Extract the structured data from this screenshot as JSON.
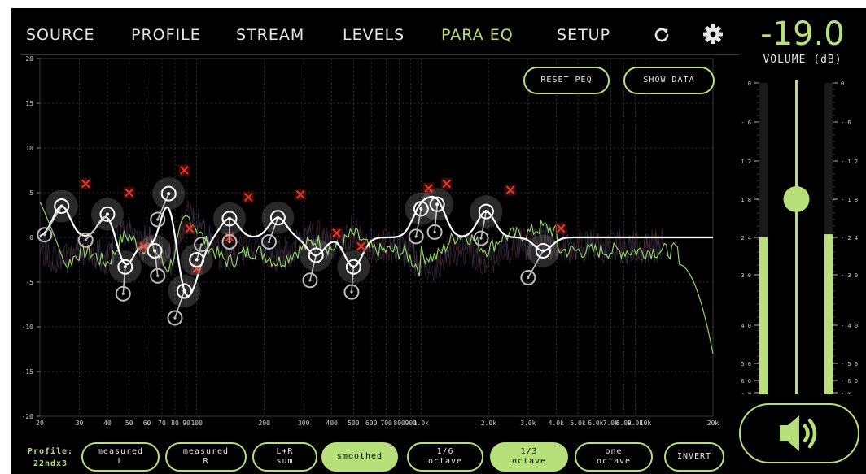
{
  "nav": {
    "tabs": [
      {
        "label": "SOURCE",
        "active": false
      },
      {
        "label": "PROFILE",
        "active": false
      },
      {
        "label": "STREAM",
        "active": false
      },
      {
        "label": "LEVELS",
        "active": false
      },
      {
        "label": "PARA EQ",
        "active": true
      },
      {
        "label": "SETUP",
        "active": false
      }
    ],
    "refresh_icon": "refresh-icon",
    "settings_icon": "gear-icon"
  },
  "volume": {
    "value": "-19.0",
    "label": "VOLUME (dB)",
    "slider_db": -18,
    "meter_left_db": -24,
    "meter_right_db": -23.5,
    "scale_left": [
      "0",
      "- 6",
      "- 1 2",
      "- 1 8",
      "- 2 4",
      "- 3 0",
      "- 4 0",
      "- 5 0",
      "- 6 0",
      "- ∞"
    ],
    "scale_right": [
      "0",
      "- 6",
      "- 1 2",
      "- 1 8",
      "- 2 4",
      "- 3 0",
      "- 4 0",
      "- 5 0",
      "- 6 0",
      "- ∞"
    ],
    "mute_icon": "speaker-icon"
  },
  "eq": {
    "reset_label": "RESET PEQ",
    "show_data_label": "SHOW DATA",
    "y_ticks": [
      "20",
      "15",
      "10",
      "5",
      "0",
      "-5",
      "-10",
      "-15",
      "-20"
    ],
    "x_ticks": [
      {
        "f": 20,
        "label": "20"
      },
      {
        "f": 30,
        "label": "30"
      },
      {
        "f": 40,
        "label": "40"
      },
      {
        "f": 50,
        "label": "50"
      },
      {
        "f": 60,
        "label": "60"
      },
      {
        "f": 70,
        "label": "70"
      },
      {
        "f": 80,
        "label": "80"
      },
      {
        "f": 90,
        "label": "90"
      },
      {
        "f": 100,
        "label": "100"
      },
      {
        "f": 200,
        "label": "200"
      },
      {
        "f": 300,
        "label": "300"
      },
      {
        "f": 400,
        "label": "400"
      },
      {
        "f": 500,
        "label": "500"
      },
      {
        "f": 600,
        "label": "600"
      },
      {
        "f": 700,
        "label": "700"
      },
      {
        "f": 800,
        "label": "800"
      },
      {
        "f": 900,
        "label": "900"
      },
      {
        "f": 1000,
        "label": "1.0k"
      },
      {
        "f": 2000,
        "label": "2.0k"
      },
      {
        "f": 3000,
        "label": "3.0k"
      },
      {
        "f": 4000,
        "label": "4.0k"
      },
      {
        "f": 5000,
        "label": "5.0k"
      },
      {
        "f": 6000,
        "label": "6.0k"
      },
      {
        "f": 7000,
        "label": "7.0k"
      },
      {
        "f": 8000,
        "label": "8.0k"
      },
      {
        "f": 9000,
        "label": "9.0k"
      },
      {
        "f": 10000,
        "label": "10k"
      },
      {
        "f": 20000,
        "label": "20k"
      }
    ],
    "colors": {
      "accent": "#b7e07a",
      "curve": "#ffffff",
      "measured": "#8fd46a",
      "marker": "#e0392b",
      "grid": "#3a3a3a"
    },
    "targets": [
      {
        "f": 32,
        "db": 6
      },
      {
        "f": 50,
        "db": 5
      },
      {
        "f": 58,
        "db": -1
      },
      {
        "f": 88,
        "db": 7.5
      },
      {
        "f": 93,
        "db": 1
      },
      {
        "f": 100,
        "db": -3.5
      },
      {
        "f": 140,
        "db": 0
      },
      {
        "f": 170,
        "db": 4.5
      },
      {
        "f": 290,
        "db": 4.8
      },
      {
        "f": 420,
        "db": 0.5
      },
      {
        "f": 540,
        "db": -1
      },
      {
        "f": 1080,
        "db": 5.5
      },
      {
        "f": 1300,
        "db": 6
      },
      {
        "f": 2500,
        "db": 5.3
      },
      {
        "f": 4200,
        "db": 1
      }
    ],
    "filters": [
      {
        "f": 25,
        "db": 3.5,
        "hf": 21,
        "hdb": 0.3
      },
      {
        "f": 40,
        "db": 2.6,
        "hf": 32,
        "hdb": -0.3
      },
      {
        "f": 48,
        "db": -3.3,
        "hf": 47,
        "hdb": -6.3
      },
      {
        "f": 75,
        "db": 4.9,
        "hf": 67,
        "hdb": 2
      },
      {
        "f": 65,
        "db": -1.5,
        "hf": 67,
        "hdb": -4.3
      },
      {
        "f": 88,
        "db": -6,
        "hf": 80,
        "hdb": -9
      },
      {
        "f": 100,
        "db": -2.5,
        "hf": 105,
        "hdb": -0.8
      },
      {
        "f": 140,
        "db": 2.1,
        "hf": 140,
        "hdb": -0.5
      },
      {
        "f": 230,
        "db": 2.2,
        "hf": 210,
        "hdb": -0.5
      },
      {
        "f": 340,
        "db": -2,
        "hf": 320,
        "hdb": -4.8
      },
      {
        "f": 500,
        "db": -3.3,
        "hf": 490,
        "hdb": -6.1
      },
      {
        "f": 1000,
        "db": 3.2,
        "hf": 950,
        "hdb": 0.1
      },
      {
        "f": 1180,
        "db": 3.7,
        "hf": 1150,
        "hdb": 0.6
      },
      {
        "f": 1950,
        "db": 2.9,
        "hf": 1850,
        "hdb": -0.1
      },
      {
        "f": 3500,
        "db": -1.5,
        "hf": 3000,
        "hdb": -4.5
      }
    ]
  },
  "bottom": {
    "profile_label": "Profile:",
    "profile_name": "22ndx3",
    "buttons": [
      {
        "line1": "measured",
        "line2": "L",
        "on": false
      },
      {
        "line1": "measured",
        "line2": "R",
        "on": false
      },
      {
        "line1": "L+R",
        "line2": "sum",
        "on": false
      },
      {
        "line1": "smoothed",
        "line2": "",
        "on": true
      },
      {
        "line1": "1/6",
        "line2": "octave",
        "on": false
      },
      {
        "line1": "1/3",
        "line2": "octave",
        "on": true
      },
      {
        "line1": "one",
        "line2": "octave",
        "on": false
      },
      {
        "line1": "INVERT",
        "line2": "",
        "on": false
      }
    ]
  }
}
